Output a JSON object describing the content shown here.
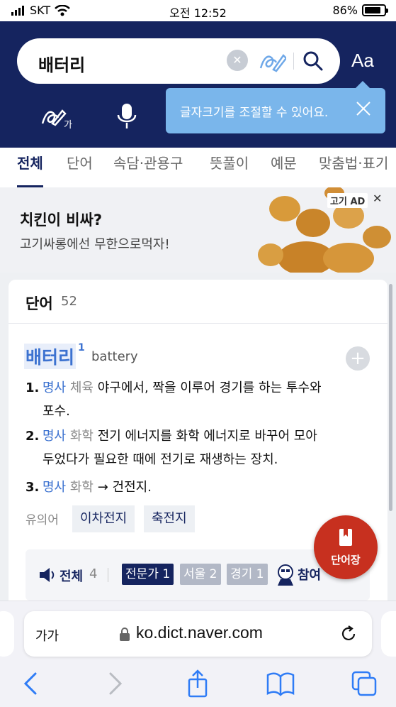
{
  "status": {
    "carrier": "SKT",
    "time": "오전 12:52",
    "battery": "86%",
    "battery_level": 0.86
  },
  "search": {
    "query": "배터리",
    "font_size_button": "Aa"
  },
  "tooltip": {
    "message": "글자크기를 조절할 수 있어요."
  },
  "tabs": [
    "전체",
    "단어",
    "속담·관용구",
    "뜻풀이",
    "예문",
    "맞춤법·표기"
  ],
  "ad": {
    "headline": "치킨이 비싸?",
    "subline": "고기싸롱에선 무한으로먹자!",
    "badge": "고기 AD"
  },
  "word_section": {
    "title": "단어",
    "count": "52",
    "entry": {
      "word": "배터리",
      "homonym": "1",
      "original": "battery",
      "definitions": [
        {
          "num": "1.",
          "pos": "명사",
          "field": "체육",
          "text": "야구에서, 짝을 이루어 경기를 하는 투수와",
          "text2": "포수."
        },
        {
          "num": "2.",
          "pos": "명사",
          "field": "화학",
          "text": "전기 에너지를 화학 에너지로 바꾸어 모아",
          "text2": "두었다가 필요한 때에 전기로 재생하는 장치."
        },
        {
          "num": "3.",
          "pos": "명사",
          "field": "화학",
          "text": "→ 건전지.",
          "text2": ""
        }
      ],
      "synonym_label": "유의어",
      "synonyms": [
        "이차전지",
        "축전지"
      ]
    },
    "sources": {
      "all_label": "전체",
      "all_count": "4",
      "chips": [
        {
          "label": "전문가 1",
          "color": "#15245f"
        },
        {
          "label": "서울 2",
          "color": "#b2b8c6"
        },
        {
          "label": "경기 1",
          "color": "#b2b8c6"
        }
      ],
      "join_label": "참여"
    }
  },
  "vocab_button": {
    "label": "단어장"
  },
  "browser": {
    "text_size": "가가",
    "domain": "ko.dict.naver.com"
  },
  "colors": {
    "header": "#15245f",
    "accent": "#3c72d0",
    "vocab": "#c7301f",
    "tooltip": "#7ab6eb"
  }
}
